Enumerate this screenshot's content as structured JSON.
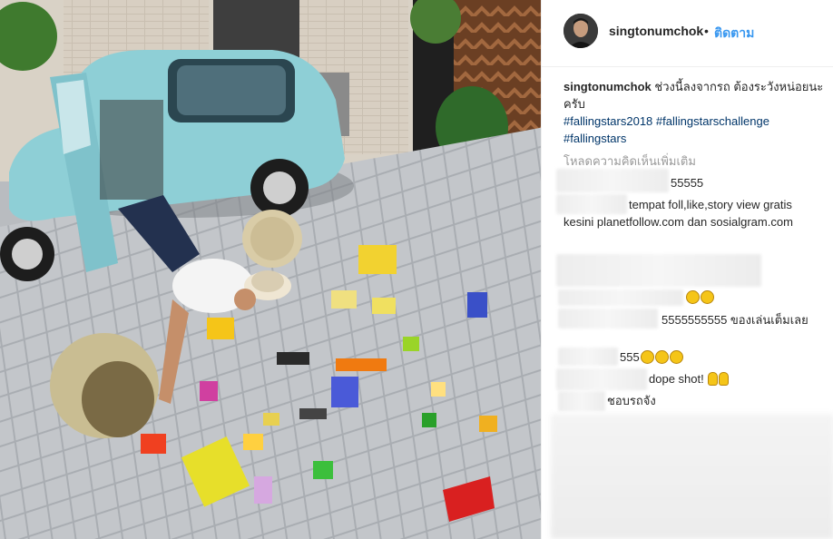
{
  "post": {
    "username": "singtonumchok",
    "separator": "•",
    "follow_label": "ติดตาม",
    "caption_user": "singtonumchok",
    "caption_text": "ช่วงนี้ลงจากรถ ต้องระวังหน่อยนะครับ",
    "hashtags": [
      "#fallingstars2018",
      "#fallingstarschallenge",
      "#fallingstars"
    ],
    "load_more_label": "โหลดความคิดเห็นเพิ่มเติม"
  },
  "comments": [
    {
      "text": "55555"
    },
    {
      "text": "tempat foll,like,story view gratis kesini planetfollow.com dan sosialgram.com"
    },
    {
      "text": ""
    },
    {
      "text": ""
    },
    {
      "text": "5555555555 ของเล่นเต็มเลย"
    },
    {
      "text": "555"
    },
    {
      "text": "dope shot!"
    },
    {
      "text": "ชอบรถจัง"
    }
  ],
  "icons": {
    "laugh_emoji": "rolling-on-floor-laughing-emoji",
    "ok_hand_emoji": "ok-hand-emoji"
  },
  "colors": {
    "link": "#003569",
    "follow": "#3897f0",
    "text": "#262626",
    "muted": "#999999",
    "car": "#8ecfd6"
  }
}
